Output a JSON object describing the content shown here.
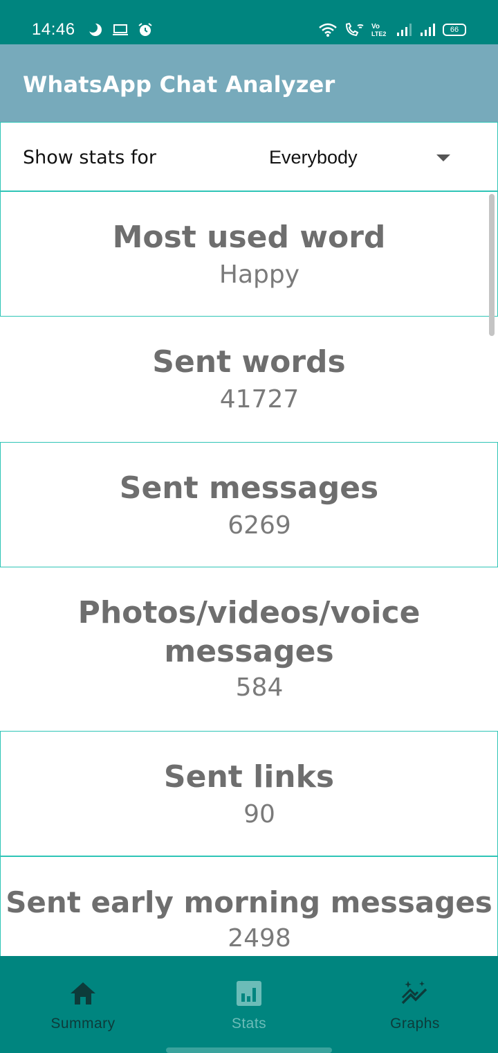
{
  "status_bar": {
    "time": "14:46",
    "battery": "66",
    "left_icons": [
      "moon-icon",
      "laptop-icon",
      "alarm-icon"
    ],
    "right_icons": [
      "wifi-icon",
      "wifi-call-icon",
      "volte-icon",
      "signal-icon",
      "signal-icon",
      "battery-icon"
    ]
  },
  "app_bar": {
    "title": "WhatsApp Chat Analyzer"
  },
  "filter": {
    "label": "Show stats for",
    "selected": "Everybody"
  },
  "stats": [
    {
      "title": "Most used word",
      "value": "Happy"
    },
    {
      "title": "Sent words",
      "value": "41727"
    },
    {
      "title": "Sent messages",
      "value": "6269"
    },
    {
      "title_line1": "Photos/videos/voice",
      "title_line2": "messages",
      "value": "584"
    },
    {
      "title": "Sent links",
      "value": "90"
    },
    {
      "title": "Sent early morning messages",
      "value": "2498"
    }
  ],
  "bottom_nav": {
    "items": [
      {
        "label": "Summary",
        "icon": "home-icon",
        "active": true
      },
      {
        "label": "Stats",
        "icon": "bar-chart-icon",
        "active": false
      },
      {
        "label": "Graphs",
        "icon": "sparkle-chart-icon",
        "active": true
      }
    ]
  },
  "colors": {
    "status_bar": "#00857f",
    "app_bar": "#77aabb",
    "card_border": "#2ec4b6",
    "bottom_nav": "#00857f"
  }
}
